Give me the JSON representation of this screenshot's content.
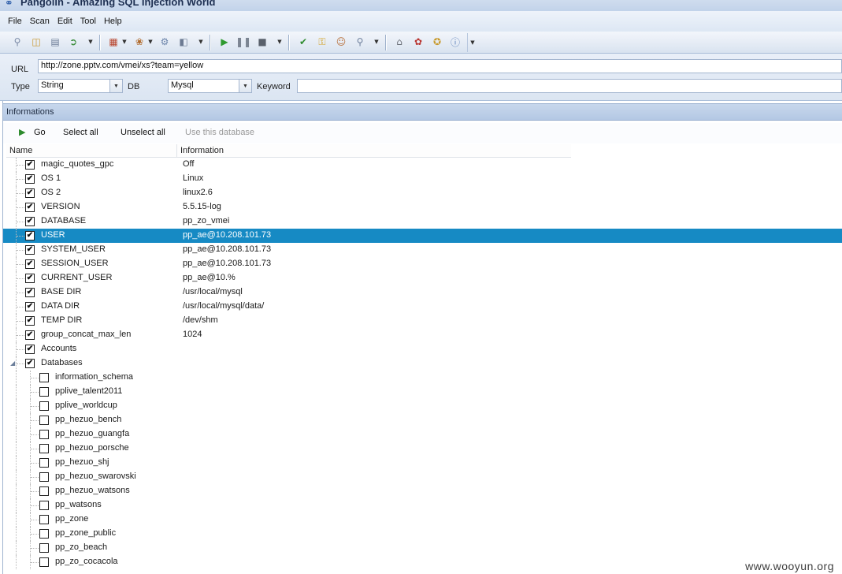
{
  "window": {
    "title": "Pangolin - Amazing SQL Injection World"
  },
  "menu": [
    "File",
    "Scan",
    "Edit",
    "Tool",
    "Help"
  ],
  "toolbar": {
    "icons": [
      "search-icon",
      "open-folder-icon",
      "save-icon",
      "export-icon",
      "tools-icon",
      "plugin-icon",
      "wrench-icon",
      "database-icon",
      "play-icon",
      "pause-icon",
      "stop-icon",
      "help-icon",
      "key-icon",
      "user-icon",
      "find-icon",
      "home-icon",
      "bug-icon",
      "update-icon",
      "info-icon"
    ]
  },
  "url_panel": {
    "url_label": "URL",
    "url_value": "http://zone.pptv.com/vmei/xs?team=yellow",
    "type_label": "Type",
    "type_value": "String",
    "db_label": "DB",
    "db_value": "Mysql",
    "keyword_label": "Keyword",
    "keyword_value": ""
  },
  "informations": {
    "header": "Informations",
    "actions": {
      "go": "Go",
      "select_all": "Select all",
      "unselect_all": "Unselect all",
      "use_db": "Use this database"
    },
    "columns": {
      "name": "Name",
      "information": "Information"
    },
    "rows": [
      {
        "name": "magic_quotes_gpc",
        "value": "Off",
        "checked": true
      },
      {
        "name": "OS 1",
        "value": "Linux",
        "checked": true
      },
      {
        "name": "OS 2",
        "value": "linux2.6",
        "checked": true
      },
      {
        "name": "VERSION",
        "value": "5.5.15-log",
        "checked": true
      },
      {
        "name": "DATABASE",
        "value": "pp_zo_vmei",
        "checked": true
      },
      {
        "name": "USER",
        "value": "pp_ae@10.208.101.73",
        "checked": true,
        "selected": true
      },
      {
        "name": "SYSTEM_USER",
        "value": "pp_ae@10.208.101.73",
        "checked": true
      },
      {
        "name": "SESSION_USER",
        "value": "pp_ae@10.208.101.73",
        "checked": true
      },
      {
        "name": "CURRENT_USER",
        "value": "pp_ae@10.%",
        "checked": true
      },
      {
        "name": "BASE DIR",
        "value": "/usr/local/mysql",
        "checked": true
      },
      {
        "name": "DATA DIR",
        "value": "/usr/local/mysql/data/",
        "checked": true
      },
      {
        "name": "TEMP DIR",
        "value": "/dev/shm",
        "checked": true
      },
      {
        "name": "group_concat_max_len",
        "value": "1024",
        "checked": true
      },
      {
        "name": "Accounts",
        "value": "",
        "checked": true
      },
      {
        "name": "Databases",
        "value": "",
        "checked": true
      }
    ],
    "databases": [
      "information_schema",
      "pplive_talent2011",
      "pplive_worldcup",
      "pp_hezuo_bench",
      "pp_hezuo_guangfa",
      "pp_hezuo_porsche",
      "pp_hezuo_shj",
      "pp_hezuo_swarovski",
      "pp_hezuo_watsons",
      "pp_watsons",
      "pp_zone",
      "pp_zone_public",
      "pp_zo_beach",
      "pp_zo_cocacola"
    ]
  },
  "watermark": "www.wooyun.org"
}
